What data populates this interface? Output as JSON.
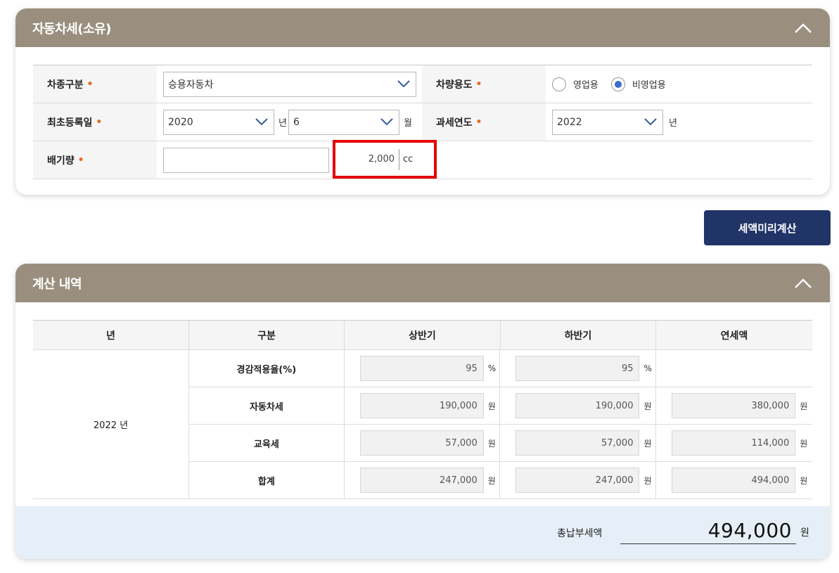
{
  "ownership": {
    "title": "자동차세(소유)",
    "fields": {
      "car_type": {
        "label": "차종구분",
        "value": "승용자동차"
      },
      "usage": {
        "label": "차량용도",
        "options": [
          "영업용",
          "비영업용"
        ],
        "selected": "비영업용"
      },
      "first_reg": {
        "label": "최초등록일",
        "year": "2020",
        "year_unit": "년",
        "month": "6",
        "month_unit": "월"
      },
      "tax_year": {
        "label": "과세연도",
        "value": "2022",
        "unit": "년"
      },
      "displacement": {
        "label": "배기량",
        "value": "2,000",
        "unit": "cc"
      }
    }
  },
  "calc_button": {
    "label": "세액미리계산"
  },
  "result": {
    "title": "계산 내역",
    "headers": [
      "년",
      "구분",
      "상반기",
      "하반기",
      "연세액"
    ],
    "year": "2022 년",
    "rows": [
      {
        "label": "경감적용율(%)",
        "h1": "95",
        "h1_unit": "%",
        "h2": "95",
        "h2_unit": "%",
        "annual": "",
        "annual_unit": ""
      },
      {
        "label": "자동차세",
        "h1": "190,000",
        "h1_unit": "원",
        "h2": "190,000",
        "h2_unit": "원",
        "annual": "380,000",
        "annual_unit": "원"
      },
      {
        "label": "교육세",
        "h1": "57,000",
        "h1_unit": "원",
        "h2": "57,000",
        "h2_unit": "원",
        "annual": "114,000",
        "annual_unit": "원"
      },
      {
        "label": "합계",
        "h1": "247,000",
        "h1_unit": "원",
        "h2": "247,000",
        "h2_unit": "원",
        "annual": "494,000",
        "annual_unit": "원"
      }
    ],
    "total": {
      "label": "총납부세액",
      "value": "494,000",
      "unit": "원"
    }
  },
  "colors": {
    "header": "#9a8f7e",
    "button": "#213468",
    "required": "#e8681f",
    "highlight": "#e60000",
    "total_bg": "#e6eff7"
  }
}
